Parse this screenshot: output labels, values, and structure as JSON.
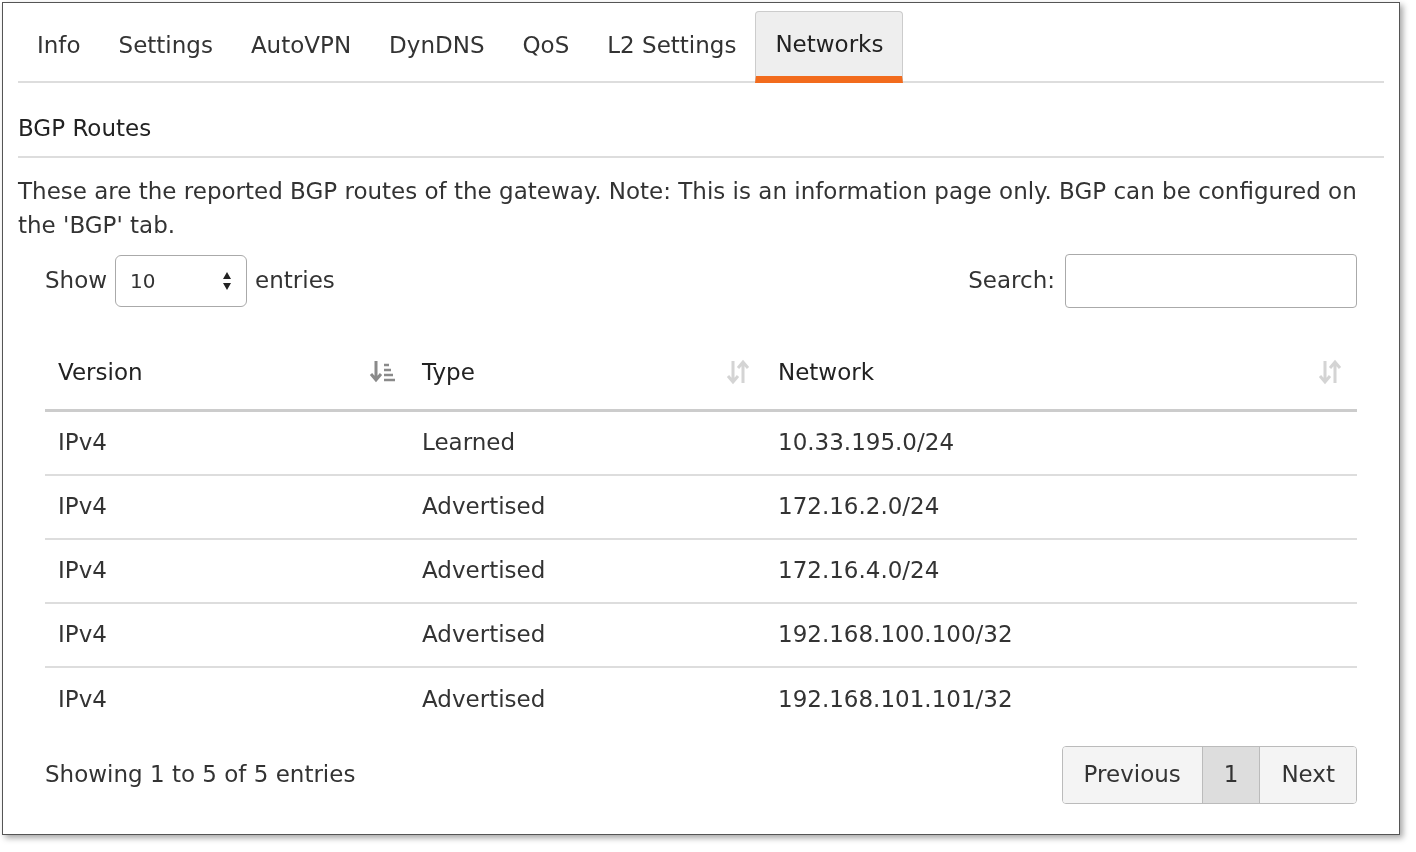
{
  "tabs": [
    {
      "label": "Info",
      "selected": false
    },
    {
      "label": "Settings",
      "selected": false
    },
    {
      "label": "AutoVPN",
      "selected": false
    },
    {
      "label": "DynDNS",
      "selected": false
    },
    {
      "label": "QoS",
      "selected": false
    },
    {
      "label": "L2 Settings",
      "selected": false
    },
    {
      "label": "Networks",
      "selected": true
    }
  ],
  "section_title": "BGP Routes",
  "description": "These are the reported BGP routes of the gateway. Note: This is an information page only. BGP can be configured on the 'BGP' tab.",
  "length_control": {
    "prefix": "Show",
    "value": "10",
    "suffix": "entries"
  },
  "search": {
    "label": "Search:"
  },
  "table": {
    "columns": [
      {
        "label": "Version",
        "sorted": true
      },
      {
        "label": "Type",
        "sorted": false
      },
      {
        "label": "Network",
        "sorted": false
      }
    ],
    "rows": [
      [
        "IPv4",
        "Learned",
        "10.33.195.0/24"
      ],
      [
        "IPv4",
        "Advertised",
        "172.16.2.0/24"
      ],
      [
        "IPv4",
        "Advertised",
        "172.16.4.0/24"
      ],
      [
        "IPv4",
        "Advertised",
        "192.168.100.100/32"
      ],
      [
        "IPv4",
        "Advertised",
        "192.168.101.101/32"
      ]
    ]
  },
  "info": "Showing 1 to 5 of 5 entries",
  "pagination": [
    {
      "label": "Previous",
      "selected": false
    },
    {
      "label": "1",
      "selected": true
    },
    {
      "label": "Next",
      "selected": false
    }
  ]
}
